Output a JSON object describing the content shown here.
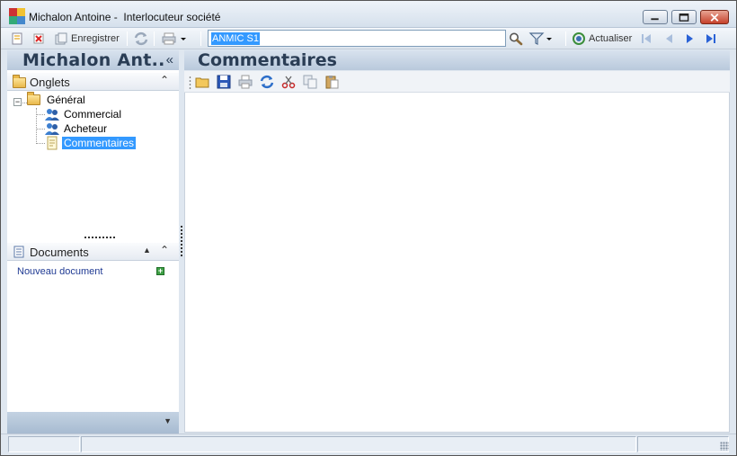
{
  "window": {
    "title": "Michalon Antoine -  Interlocuteur société"
  },
  "toolbar": {
    "save_label": "Enregistrer",
    "search_value": "ANMIC S1",
    "refresh_label": "Actualiser"
  },
  "left_panel": {
    "header": "Michalon Ant..",
    "collapse_glyph": "«",
    "onglets_title": "Onglets",
    "tree": {
      "root": "Général",
      "children": [
        "Commercial",
        "Acheteur",
        "Commentaires"
      ]
    },
    "documents_title": "Documents",
    "new_document_link": "Nouveau document"
  },
  "right_panel": {
    "header": "Commentaires"
  },
  "colors": {
    "selection": "#3399ff",
    "header_text": "#2a3d55",
    "link": "#1f3a93"
  }
}
